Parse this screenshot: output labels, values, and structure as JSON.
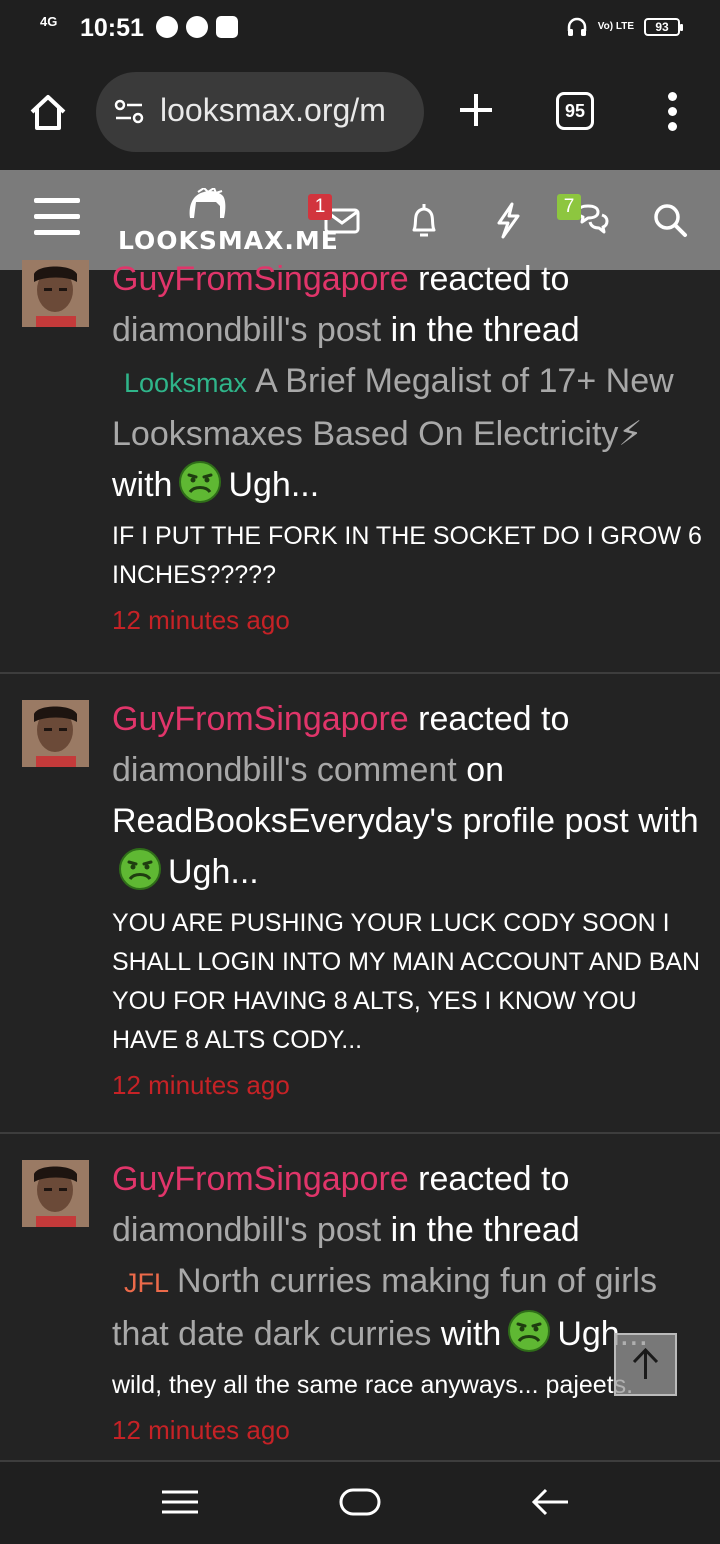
{
  "status_bar": {
    "network": "4G",
    "time": "10:51",
    "volte": "Vo) LTE",
    "battery": "93"
  },
  "browser": {
    "url": "looksmax.org/m",
    "tab_count": "95"
  },
  "site_header": {
    "logo_text": "LOOKSMAX.ME",
    "inbox_badge": "1",
    "conversations_badge": "7"
  },
  "feed": [
    {
      "user": "GuyFromSingapore",
      "action": "reacted to",
      "target": "diamondbill's post",
      "connector": "in the thread",
      "prefix": "Looksmax",
      "thread_title": "A Brief Megalist of 17+ New Looksmaxes Based On Electricity⚡",
      "with_text": "with",
      "reaction": "Ugh...",
      "snippet": "IF I PUT THE FORK IN THE SOCKET DO I GROW 6 INCHES?????",
      "time": "12 minutes ago"
    },
    {
      "user": "GuyFromSingapore",
      "action": "reacted to",
      "target": "diamondbill's comment",
      "connector": "on",
      "owner_post": "ReadBooksEveryday's profile post",
      "with_text": "with",
      "reaction": "Ugh...",
      "snippet": "YOU ARE PUSHING YOUR LUCK CODY SOON I SHALL LOGIN INTO MY MAIN ACCOUNT AND BAN YOU FOR HAVING 8 ALTS, YES I KNOW YOU HAVE 8 ALTS CODY...",
      "time": "12 minutes ago"
    },
    {
      "user": "GuyFromSingapore",
      "action": "reacted to",
      "target": "diamondbill's post",
      "connector": "in the thread",
      "prefix": "JFL",
      "thread_title": "North curries making fun of girls that date dark curries",
      "with_text": "with",
      "reaction": "Ugh...",
      "snippet": "wild, they all the same race anyways... pajeets.",
      "time": "12 minutes ago"
    }
  ],
  "colors": {
    "username": "#e0356a",
    "timestamp": "#c62226",
    "prefix_looksmax": "#2fb58a",
    "prefix_jfl": "#ec6a4a",
    "header_bg": "#7b7b7b",
    "page_bg": "#232323"
  }
}
